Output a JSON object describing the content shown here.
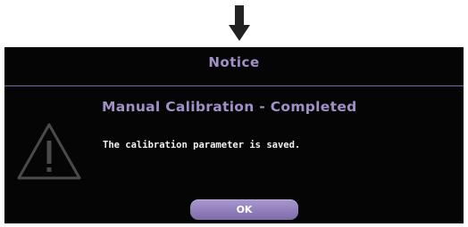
{
  "dialog": {
    "title": "Notice",
    "heading": "Manual Calibration - Completed",
    "message": "The calibration parameter is saved.",
    "ok_label": "OK"
  },
  "icons": {
    "pointer": "down-arrow-icon",
    "status": "warning-icon"
  },
  "colors": {
    "accent": "#a290c8",
    "background": "#050505",
    "button": "#8f7dbd"
  }
}
